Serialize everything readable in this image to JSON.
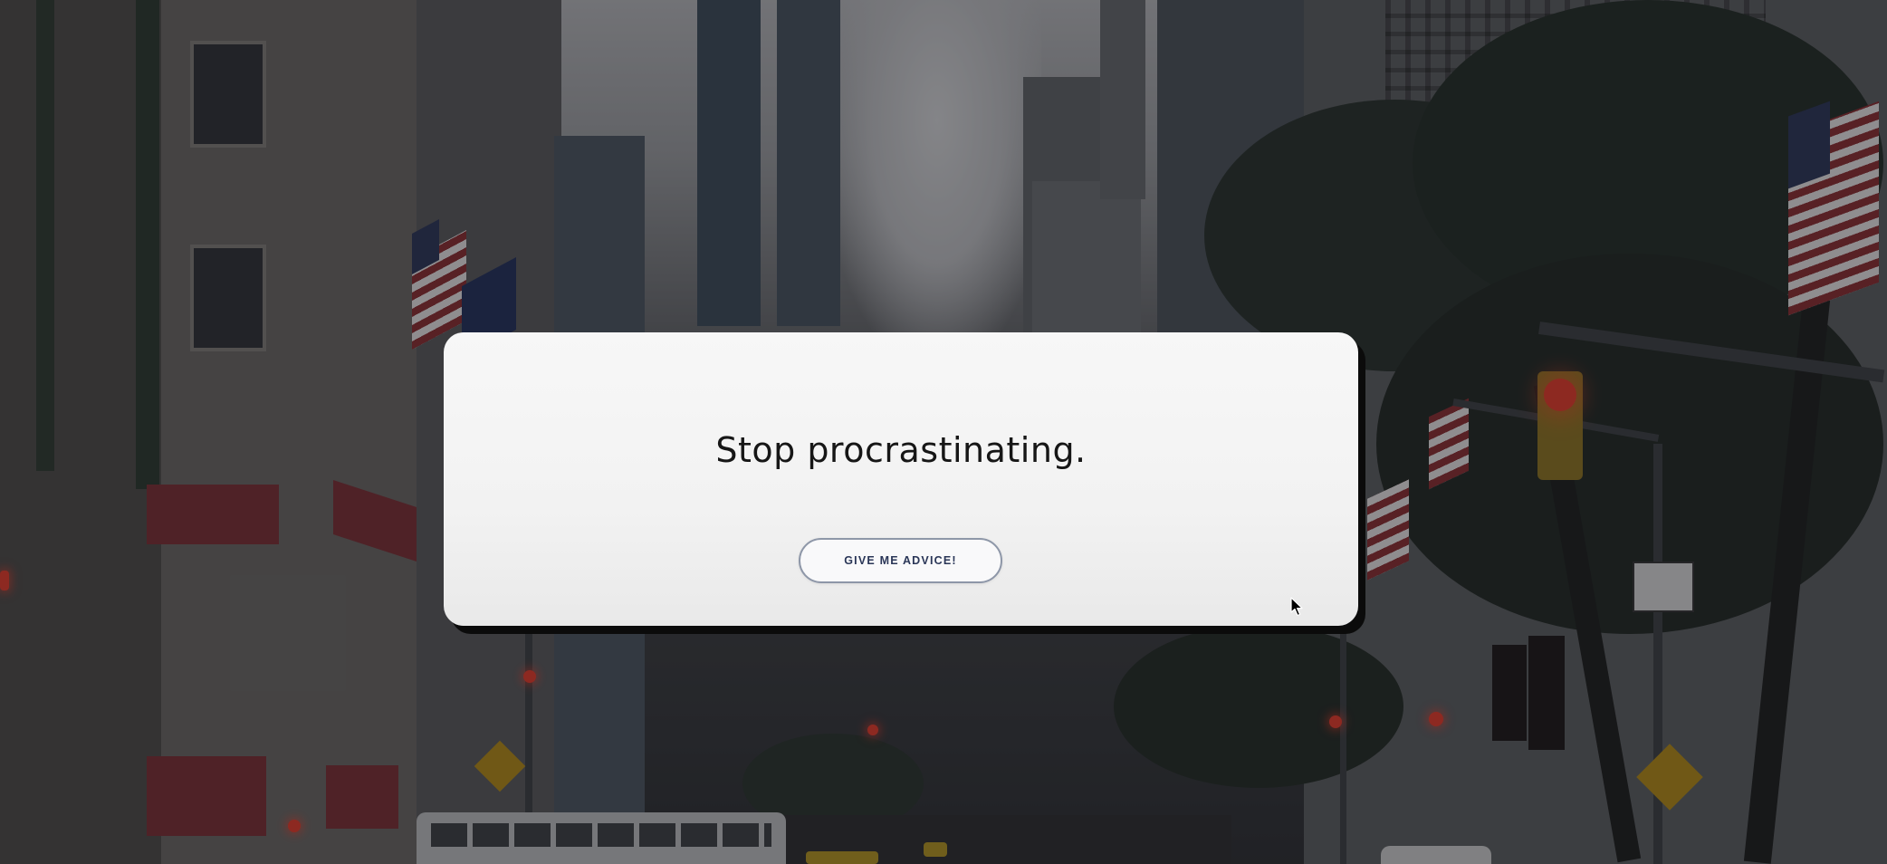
{
  "modal": {
    "title": "Stop procrastinating.",
    "button_label": "GIVE ME ADVICE!"
  },
  "colors": {
    "card_background": "#f4f4f4",
    "card_shadow": "#0b0b0b",
    "title_text": "#161616",
    "button_border": "#8e97a8",
    "button_text": "#2a3657",
    "background_overlay": "#121418"
  },
  "icons": {
    "cursor": "mouse-pointer-icon"
  }
}
